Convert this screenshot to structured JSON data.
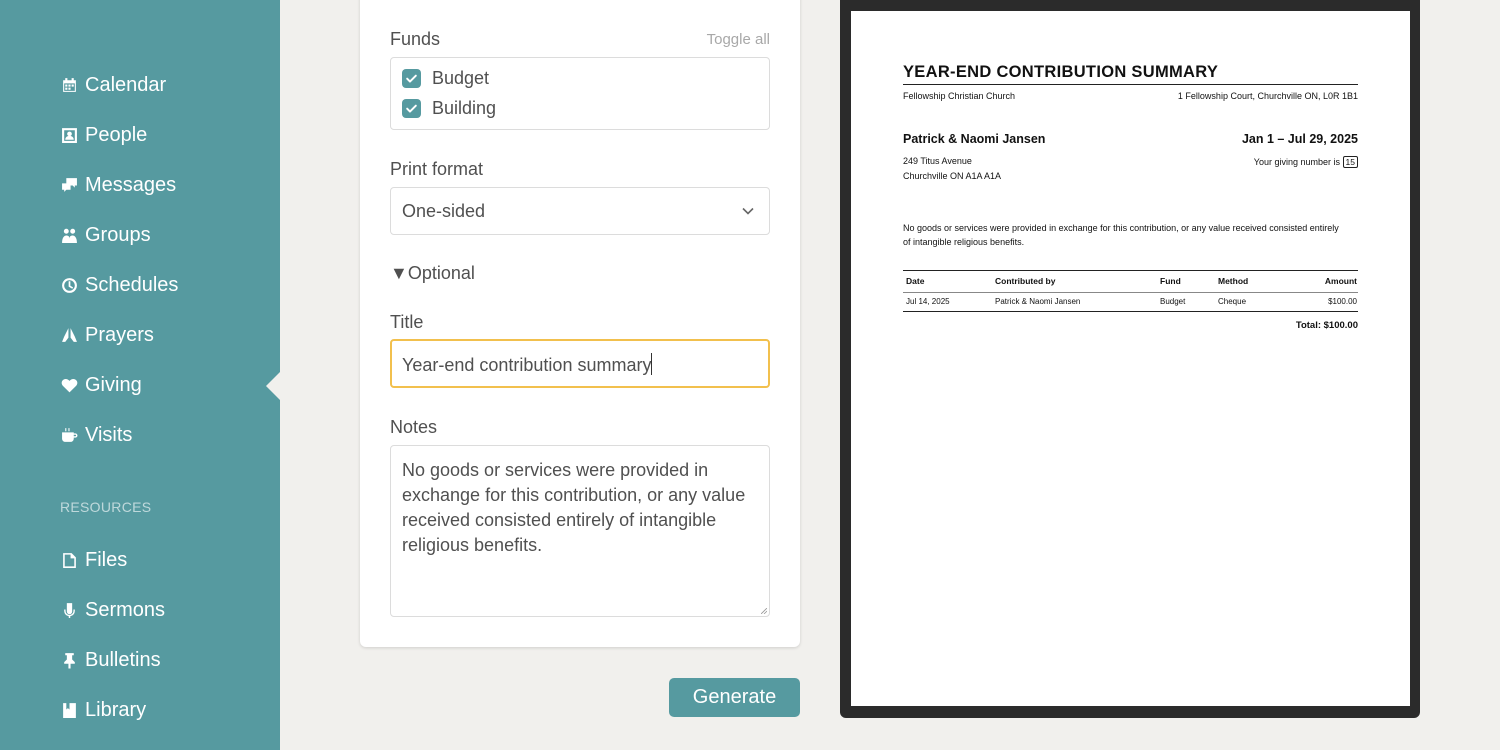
{
  "sidebar": {
    "items": [
      {
        "label": "Calendar",
        "icon": "calendar-icon"
      },
      {
        "label": "People",
        "icon": "person-icon"
      },
      {
        "label": "Messages",
        "icon": "messages-icon"
      },
      {
        "label": "Groups",
        "icon": "groups-icon"
      },
      {
        "label": "Schedules",
        "icon": "clock-icon"
      },
      {
        "label": "Prayers",
        "icon": "praying-hands-icon"
      },
      {
        "label": "Giving",
        "icon": "heart-icon",
        "active": true
      },
      {
        "label": "Visits",
        "icon": "coffee-cup-icon"
      }
    ],
    "resources_label": "RESOURCES",
    "resources": [
      {
        "label": "Files",
        "icon": "file-icon"
      },
      {
        "label": "Sermons",
        "icon": "microphone-icon"
      },
      {
        "label": "Bulletins",
        "icon": "pin-icon"
      },
      {
        "label": "Library",
        "icon": "book-icon"
      }
    ]
  },
  "form": {
    "funds_label": "Funds",
    "toggle_all": "Toggle all",
    "funds": [
      {
        "label": "Budget",
        "checked": true
      },
      {
        "label": "Building",
        "checked": true
      }
    ],
    "print_format_label": "Print format",
    "print_format_value": "One-sided",
    "optional_label": "Optional",
    "title_label": "Title",
    "title_value": "Year-end contribution summary",
    "notes_label": "Notes",
    "notes_value": "No goods or services were provided in exchange for this contribution, or any value received consisted entirely of intangible religious benefits.",
    "generate_label": "Generate"
  },
  "preview": {
    "title": "YEAR-END CONTRIBUTION SUMMARY",
    "church_name": "Fellowship Christian Church",
    "church_address": "1 Fellowship Court, Churchville ON, L0R 1B1",
    "donor_name": "Patrick & Naomi Jansen",
    "date_range": "Jan 1 – Jul 29, 2025",
    "address_line1": "249 Titus Avenue",
    "address_line2": "Churchville ON A1A A1A",
    "giving_number_label": "Your giving number is",
    "giving_number": "15",
    "notes_line1": "No goods or services were provided in exchange for this contribution, or any value received consisted entirely",
    "notes_line2": "of intangible religious benefits.",
    "table": {
      "headers": [
        "Date",
        "Contributed by",
        "Fund",
        "Method",
        "Amount"
      ],
      "rows": [
        [
          "Jul 14, 2025",
          "Patrick & Naomi Jansen",
          "Budget",
          "Cheque",
          "$100.00"
        ]
      ]
    },
    "total": "Total: $100.00"
  },
  "colors": {
    "sidebar": "#569aa0",
    "accent": "#569aa0",
    "focus_border": "#f2c04d",
    "background": "#f1f0ed"
  }
}
